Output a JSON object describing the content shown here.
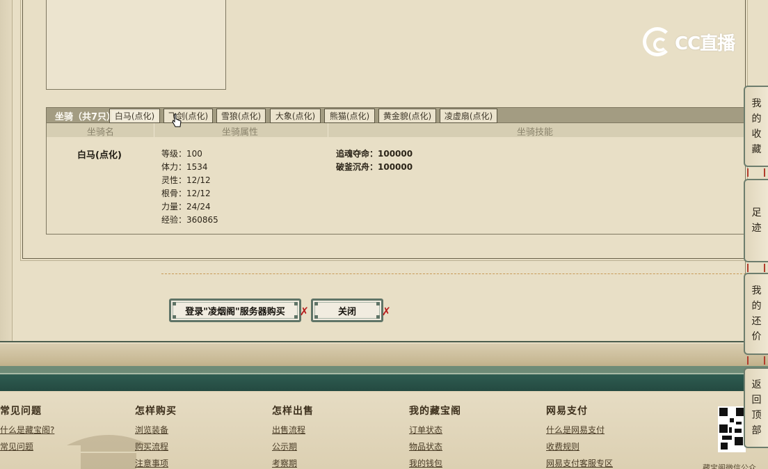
{
  "watermark": {
    "text": "CC直播"
  },
  "mount": {
    "title": "坐骑（共7只）",
    "tabs": [
      {
        "label": "白马(点化)",
        "active": true
      },
      {
        "label": "飞剑(点化)",
        "active": false
      },
      {
        "label": "雪狼(点化)",
        "active": false
      },
      {
        "label": "大象(点化)",
        "active": false
      },
      {
        "label": "熊猫(点化)",
        "active": false
      },
      {
        "label": "黄金貌(点化)",
        "active": false
      },
      {
        "label": "凌虚扇(点化)",
        "active": false
      }
    ],
    "columns": {
      "name": "坐骑名",
      "attributes": "坐骑属性",
      "skills": "坐骑技能"
    },
    "name": "白马(点化)",
    "attributes": [
      "等级：100",
      "体力：1534",
      "灵性：12/12",
      "根骨：12/12",
      "力量：24/24",
      "经验：360865"
    ],
    "skills": [
      "追魂夺命：100000",
      "破釜沉舟：100000"
    ]
  },
  "buttons": {
    "login_buy": "登录\"凌烟阁\"服务器购买",
    "close": "关闭"
  },
  "side_float": [
    {
      "label": "我的收藏"
    },
    {
      "label": "足迹"
    },
    {
      "label": "我的还价"
    },
    {
      "label": "返回顶部"
    }
  ],
  "footer": {
    "columns": [
      {
        "title": "常见问题",
        "links": [
          "什么是藏宝阁?",
          "常见问题"
        ]
      },
      {
        "title": "怎样购买",
        "links": [
          "浏览装备",
          "购买流程",
          "注意事项"
        ]
      },
      {
        "title": "怎样出售",
        "links": [
          "出售流程",
          "公示期",
          "考察期"
        ]
      },
      {
        "title": "我的藏宝阁",
        "links": [
          "订单状态",
          "物品状态",
          "我的钱包"
        ]
      },
      {
        "title": "网易支付",
        "links": [
          "什么是网易支付",
          "收费规则",
          "网易支付客服专区"
        ]
      }
    ],
    "wechat_tip": "藏宝阁微信公众"
  },
  "colors": {
    "panel_bg": "#e8dfc6",
    "tab_strip": "#a39c82",
    "teal_bar": "#2e5c51",
    "button_border": "#5f7467",
    "knot_red": "#b71e1e"
  }
}
